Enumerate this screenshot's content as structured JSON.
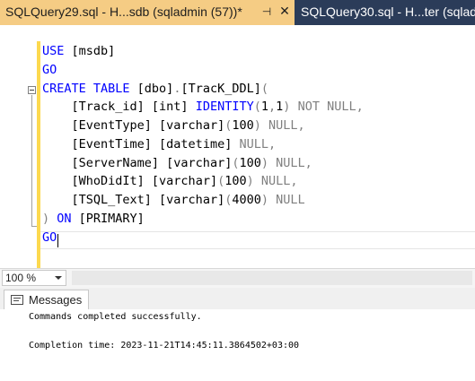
{
  "tabs": {
    "active": {
      "title": "SQLQuery29.sql - H...sdb (sqladmin (57))*",
      "pin_glyph": "⊣",
      "close_glyph": "✕"
    },
    "inactive": {
      "title": "SQLQuery30.sql - H...ter (sqladmin"
    }
  },
  "editor": {
    "lines": [
      {
        "spans": [
          {
            "t": "USE",
            "c": "kw"
          },
          {
            "t": " [msdb]",
            "c": "tx"
          }
        ]
      },
      {
        "spans": [
          {
            "t": "GO",
            "c": "kw"
          }
        ]
      },
      {
        "spans": [
          {
            "t": "CREATE TABLE",
            "c": "kw"
          },
          {
            "t": " [dbo]",
            "c": "tx"
          },
          {
            "t": ".",
            "c": "gy"
          },
          {
            "t": "[TracK_DDL]",
            "c": "tx"
          },
          {
            "t": "(",
            "c": "gy"
          }
        ]
      },
      {
        "spans": [
          {
            "t": "    [Track_id] ",
            "c": "tx"
          },
          {
            "t": "[int]",
            "c": "tx"
          },
          {
            "t": " ",
            "c": "tx"
          },
          {
            "t": "IDENTITY",
            "c": "kw"
          },
          {
            "t": "(",
            "c": "gy"
          },
          {
            "t": "1",
            "c": "tx"
          },
          {
            "t": ",",
            "c": "gy"
          },
          {
            "t": "1",
            "c": "tx"
          },
          {
            "t": ")",
            "c": "gy"
          },
          {
            "t": " NOT NULL,",
            "c": "gy"
          }
        ]
      },
      {
        "spans": [
          {
            "t": "    [EventType] ",
            "c": "tx"
          },
          {
            "t": "[varchar]",
            "c": "tx"
          },
          {
            "t": "(",
            "c": "gy"
          },
          {
            "t": "100",
            "c": "tx"
          },
          {
            "t": ")",
            "c": "gy"
          },
          {
            "t": " NULL,",
            "c": "gy"
          }
        ]
      },
      {
        "spans": [
          {
            "t": "    [EventTime] ",
            "c": "tx"
          },
          {
            "t": "[datetime]",
            "c": "tx"
          },
          {
            "t": " NULL,",
            "c": "gy"
          }
        ]
      },
      {
        "spans": [
          {
            "t": "    [ServerName] ",
            "c": "tx"
          },
          {
            "t": "[varchar]",
            "c": "tx"
          },
          {
            "t": "(",
            "c": "gy"
          },
          {
            "t": "100",
            "c": "tx"
          },
          {
            "t": ")",
            "c": "gy"
          },
          {
            "t": " NULL,",
            "c": "gy"
          }
        ]
      },
      {
        "spans": [
          {
            "t": "    [WhoDidIt] ",
            "c": "tx"
          },
          {
            "t": "[varchar]",
            "c": "tx"
          },
          {
            "t": "(",
            "c": "gy"
          },
          {
            "t": "100",
            "c": "tx"
          },
          {
            "t": ")",
            "c": "gy"
          },
          {
            "t": " NULL,",
            "c": "gy"
          }
        ]
      },
      {
        "spans": [
          {
            "t": "    [TSQL_Text] ",
            "c": "tx"
          },
          {
            "t": "[varchar]",
            "c": "tx"
          },
          {
            "t": "(",
            "c": "gy"
          },
          {
            "t": "4000",
            "c": "tx"
          },
          {
            "t": ")",
            "c": "gy"
          },
          {
            "t": " NULL",
            "c": "gy"
          }
        ]
      },
      {
        "spans": [
          {
            "t": ")",
            "c": "gy"
          },
          {
            "t": " ON ",
            "c": "kw"
          },
          {
            "t": "[PRIMARY]",
            "c": "tx"
          }
        ]
      },
      {
        "spans": [
          {
            "t": "GO",
            "c": "kw"
          }
        ]
      }
    ]
  },
  "zoom": {
    "value": "100 %"
  },
  "results": {
    "tab_label": "Messages",
    "messages": [
      "Commands completed successfully.",
      "",
      "Completion time: 2023-11-21T14:45:11.3864502+03:00"
    ]
  },
  "colors": {
    "tab_active_bg": "#f5cc84",
    "tabstrip_bg": "#2b3c59",
    "keyword": "#0000ff",
    "operator_gray": "#808080",
    "change_bar": "#fcd94f"
  }
}
